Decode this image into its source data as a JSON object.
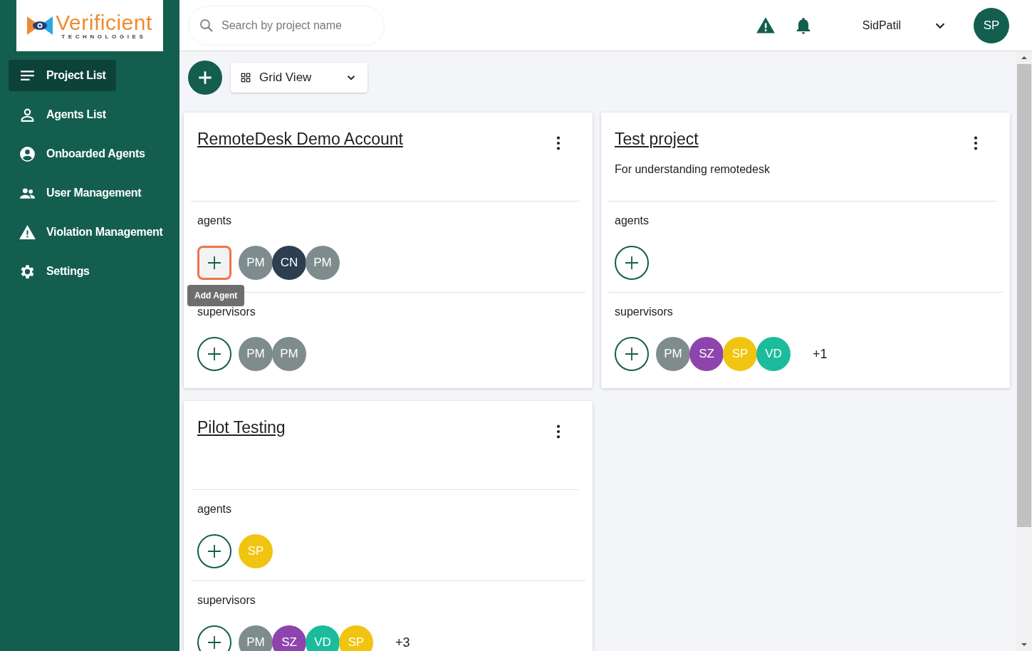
{
  "logo": {
    "name": "Verificient",
    "tagline": "TECHNOLOGIES"
  },
  "search": {
    "placeholder": "Search by project name"
  },
  "user": {
    "name": "SidPatil",
    "initials": "SP"
  },
  "sidebar": {
    "items": [
      {
        "label": "Project List",
        "selected": true
      },
      {
        "label": "Agents List",
        "selected": false
      },
      {
        "label": "Onboarded Agents",
        "selected": false
      },
      {
        "label": "User Management",
        "selected": false
      },
      {
        "label": "Violation Management",
        "selected": false
      },
      {
        "label": "Settings",
        "selected": false
      }
    ]
  },
  "toolbar": {
    "view": "Grid View"
  },
  "projects": [
    {
      "title": "RemoteDesk Demo Account",
      "sections": [
        {
          "label": "agents",
          "focused": true,
          "tooltip": "Add Agent",
          "members": [
            {
              "initials": "PM",
              "color": "#7f8c8d"
            },
            {
              "initials": "CN",
              "color": "#2c3e50"
            },
            {
              "initials": "PM",
              "color": "#7f8c8d"
            }
          ]
        },
        {
          "label": "supervisors",
          "focused": false,
          "members": [
            {
              "initials": "PM",
              "color": "#7f8c8d"
            },
            {
              "initials": "PM",
              "color": "#7f8c8d"
            }
          ]
        }
      ]
    },
    {
      "title": "Test project",
      "description": "For understanding remotedesk",
      "sections": [
        {
          "label": "agents",
          "focused": false
        },
        {
          "label": "supervisors",
          "focused": false,
          "members": [
            {
              "initials": "PM",
              "color": "#7f8c8d"
            },
            {
              "initials": "SZ",
              "color": "#8e44ad"
            },
            {
              "initials": "SP",
              "color": "#f1c40f"
            },
            {
              "initials": "VD",
              "color": "#1abc9c"
            }
          ],
          "extra": "+1"
        }
      ]
    },
    {
      "title": "Pilot Testing",
      "sections": [
        {
          "label": "agents",
          "focused": false,
          "members": [
            {
              "initials": "SP",
              "color": "#f1c40f"
            }
          ]
        },
        {
          "label": "supervisors",
          "focused": false,
          "members": [
            {
              "initials": "PM",
              "color": "#7f8c8d"
            },
            {
              "initials": "SZ",
              "color": "#8e44ad"
            },
            {
              "initials": "VD",
              "color": "#1abc9c"
            },
            {
              "initials": "SP",
              "color": "#f1c40f"
            }
          ],
          "extra": "+3"
        }
      ]
    }
  ]
}
